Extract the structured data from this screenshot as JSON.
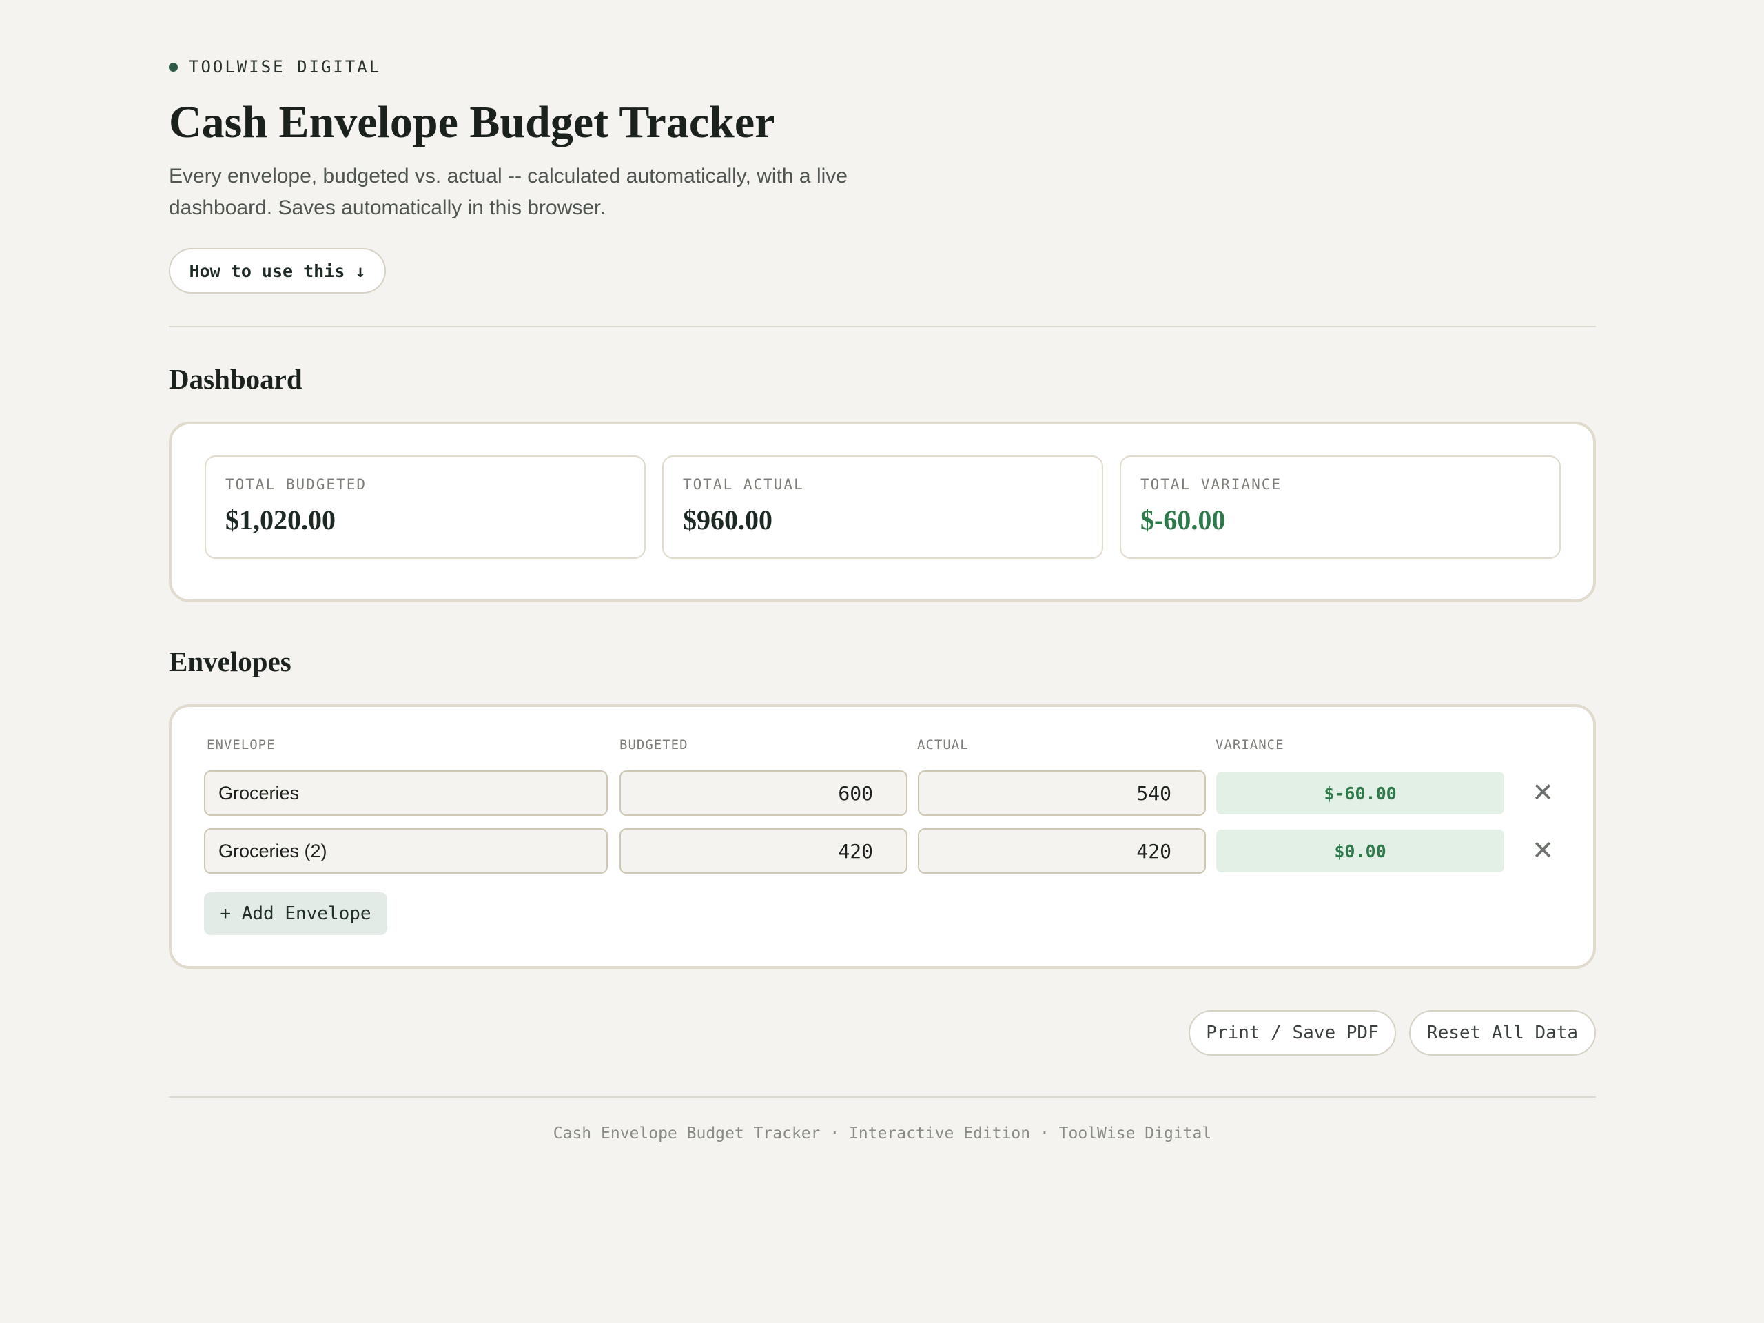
{
  "brand": {
    "name": "TOOLWISE DIGITAL"
  },
  "header": {
    "title": "Cash Envelope Budget Tracker",
    "subtitle": "Every envelope, budgeted vs. actual -- calculated automatically, with a live dashboard. Saves automatically in this browser.",
    "howto_label": "How to use this ↓"
  },
  "dashboard": {
    "title": "Dashboard",
    "cards": [
      {
        "label": "TOTAL BUDGETED",
        "value": "$1,020.00"
      },
      {
        "label": "TOTAL ACTUAL",
        "value": "$960.00"
      },
      {
        "label": "TOTAL VARIANCE",
        "value": "$-60.00"
      }
    ]
  },
  "envelopes": {
    "title": "Envelopes",
    "columns": {
      "envelope": "ENVELOPE",
      "budgeted": "BUDGETED",
      "actual": "ACTUAL",
      "variance": "VARIANCE"
    },
    "rows": [
      {
        "name": "Groceries",
        "budgeted": "600",
        "actual": "540",
        "variance": "$-60.00"
      },
      {
        "name": "Groceries (2)",
        "budgeted": "420",
        "actual": "420",
        "variance": "$0.00"
      }
    ],
    "remove_glyph": "✕",
    "add_label": "+ Add Envelope"
  },
  "actions": {
    "print_label": "Print / Save PDF",
    "reset_label": "Reset All Data"
  },
  "footer": {
    "text": "Cash Envelope Budget Tracker · Interactive Edition · ToolWise Digital"
  },
  "colors": {
    "accent": "#2d5a44",
    "positive": "#2e7a4b",
    "background": "#f4f3ef"
  }
}
